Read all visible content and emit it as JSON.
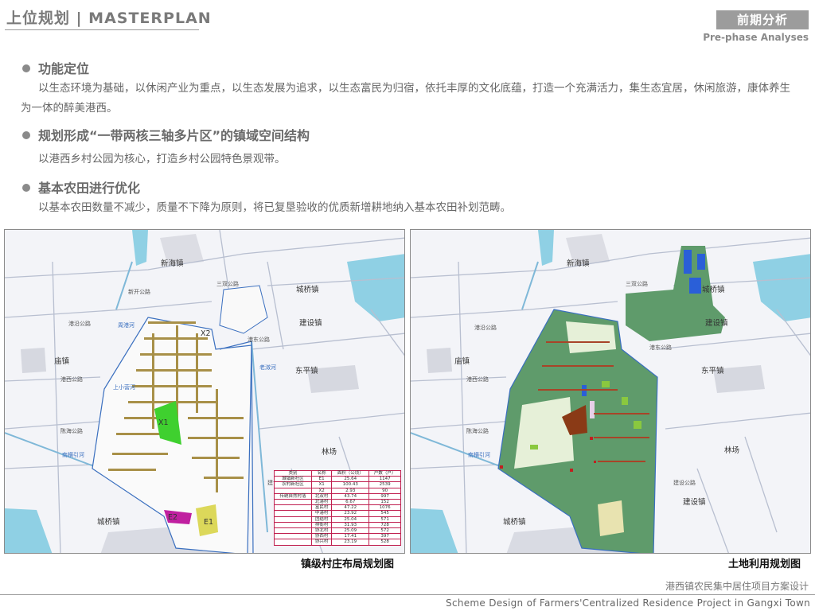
{
  "header": {
    "title": "上位规划 | MASTERPLAN",
    "badge": "前期分析",
    "badge_sub": "Pre-phase Analyses"
  },
  "sections": [
    {
      "heading": "功能定位",
      "text": "以生态环境为基础，以休闲产业为重点，以生态发展为追求，以生态富民为归宿，依托丰厚的文化底蕴，打造一个充满活力，集生态宜居，休闲旅游，康体养生为一体的醉美港西。"
    },
    {
      "heading": "规划形成“一带两核三轴多片区”的镇域空间结构",
      "text": "以港西乡村公园为核心，打造乡村公园特色景观带。"
    },
    {
      "heading": "基本农田进行优化",
      "text": "以基本农田数量不减少，质量不下降为原则，将已复垦验收的优质新增耕地纳入基本农田补划范畴。"
    }
  ],
  "map_labels": {
    "town_xinhai": "新海镇",
    "town_chengqiao": "城桥镇",
    "town_jianshe": "建设镇",
    "town_miao": "庙镇",
    "town_dongping": "东平镇",
    "town_linchang": "林场",
    "town_chengqiao_south": "城桥镇",
    "road_gangyan": "港沿公路",
    "road_gangxi": "港西公路",
    "road_chenhai": "陈海公路",
    "road_xinkai": "新开公路",
    "road_sanshuang": "三双公路",
    "road_gangdong": "港东公路",
    "road_jianshe": "建设公路",
    "river_nanheng": "南横引河",
    "river_shangxiao": "上小营河",
    "river_laodong": "老滧河",
    "river_zhouhe": "周港河",
    "zone_x1": "X1",
    "zone_x2": "X2",
    "zone_e1": "E1",
    "zone_e2": "E2"
  },
  "legend_table": {
    "headers": [
      "类别",
      "名称",
      "面积（公顷）",
      "户数（户）"
    ],
    "rows": [
      [
        "城镇新社区",
        "E1",
        "25.64",
        "1147"
      ],
      [
        "农村新社区",
        "X1",
        "100.43",
        "2539"
      ],
      [
        "",
        "X2",
        "2.93",
        "90"
      ],
      [
        "传统自然村落",
        "北双村",
        "43.74",
        "997"
      ],
      [
        "",
        "北港村",
        "6.67",
        "152"
      ],
      [
        "",
        "富民村",
        "47.22",
        "1076"
      ],
      [
        "",
        "中港村",
        "23.92",
        "545"
      ],
      [
        "",
        "团结村",
        "25.04",
        "571"
      ],
      [
        "",
        "排衙村",
        "31.93",
        "728"
      ],
      [
        "",
        "协北村",
        "25.09",
        "572"
      ],
      [
        "",
        "协西村",
        "17.41",
        "397"
      ],
      [
        "",
        "协兴村",
        "23.19",
        "528"
      ]
    ]
  },
  "captions": {
    "left": "镇级村庄布局规划图",
    "right": "土地利用规划图"
  },
  "footer": {
    "cn": "港西镇农民集中居住项目方案设计",
    "en": "Scheme Design of Farmers'Centralized Residence Project in Gangxi Town"
  }
}
